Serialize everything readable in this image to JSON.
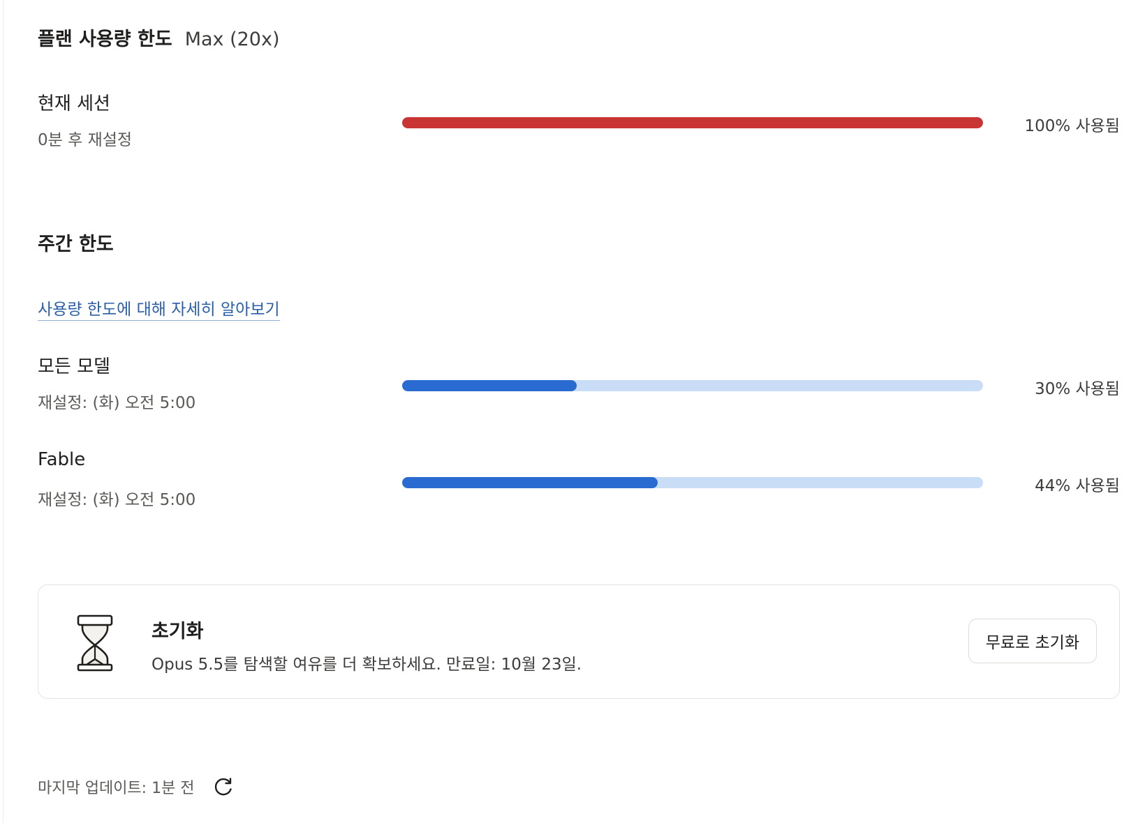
{
  "header": {
    "title": "플랜 사용량 한도",
    "plan": "Max (20x)"
  },
  "current_session": {
    "label": "현재 세션",
    "reset": "0분 후 재설정",
    "percent_text": "100% 사용됨",
    "used_fraction": 1.0,
    "fill_color": "#c93533",
    "track_color": "#f3c8c6"
  },
  "weekly": {
    "heading": "주간 한도",
    "learn_more": "사용량 한도에 대해 자세히 알아보기",
    "rows": [
      {
        "label": "모든 모델",
        "reset": "재설정: (화) 오전 5:00",
        "percent_text": "30% 사용됨",
        "used_fraction": 0.3,
        "fill_color": "#2a6bd1",
        "track_color": "#c9ddf6"
      },
      {
        "label": "Fable",
        "reset": "재설정: (화) 오전 5:00",
        "percent_text": "44% 사용됨",
        "used_fraction": 0.44,
        "fill_color": "#2a6bd1",
        "track_color": "#c9ddf6"
      }
    ]
  },
  "reset_card": {
    "icon": "hourglass-icon",
    "title": "초기화",
    "description": "Opus 5.5를 탐색할 여유를 더 확보하세요. 만료일: 10월 23일.",
    "button": "무료로 초기화"
  },
  "footer": {
    "last_updated": "마지막 업데이트: 1분 전",
    "refresh_icon": "refresh-icon"
  }
}
